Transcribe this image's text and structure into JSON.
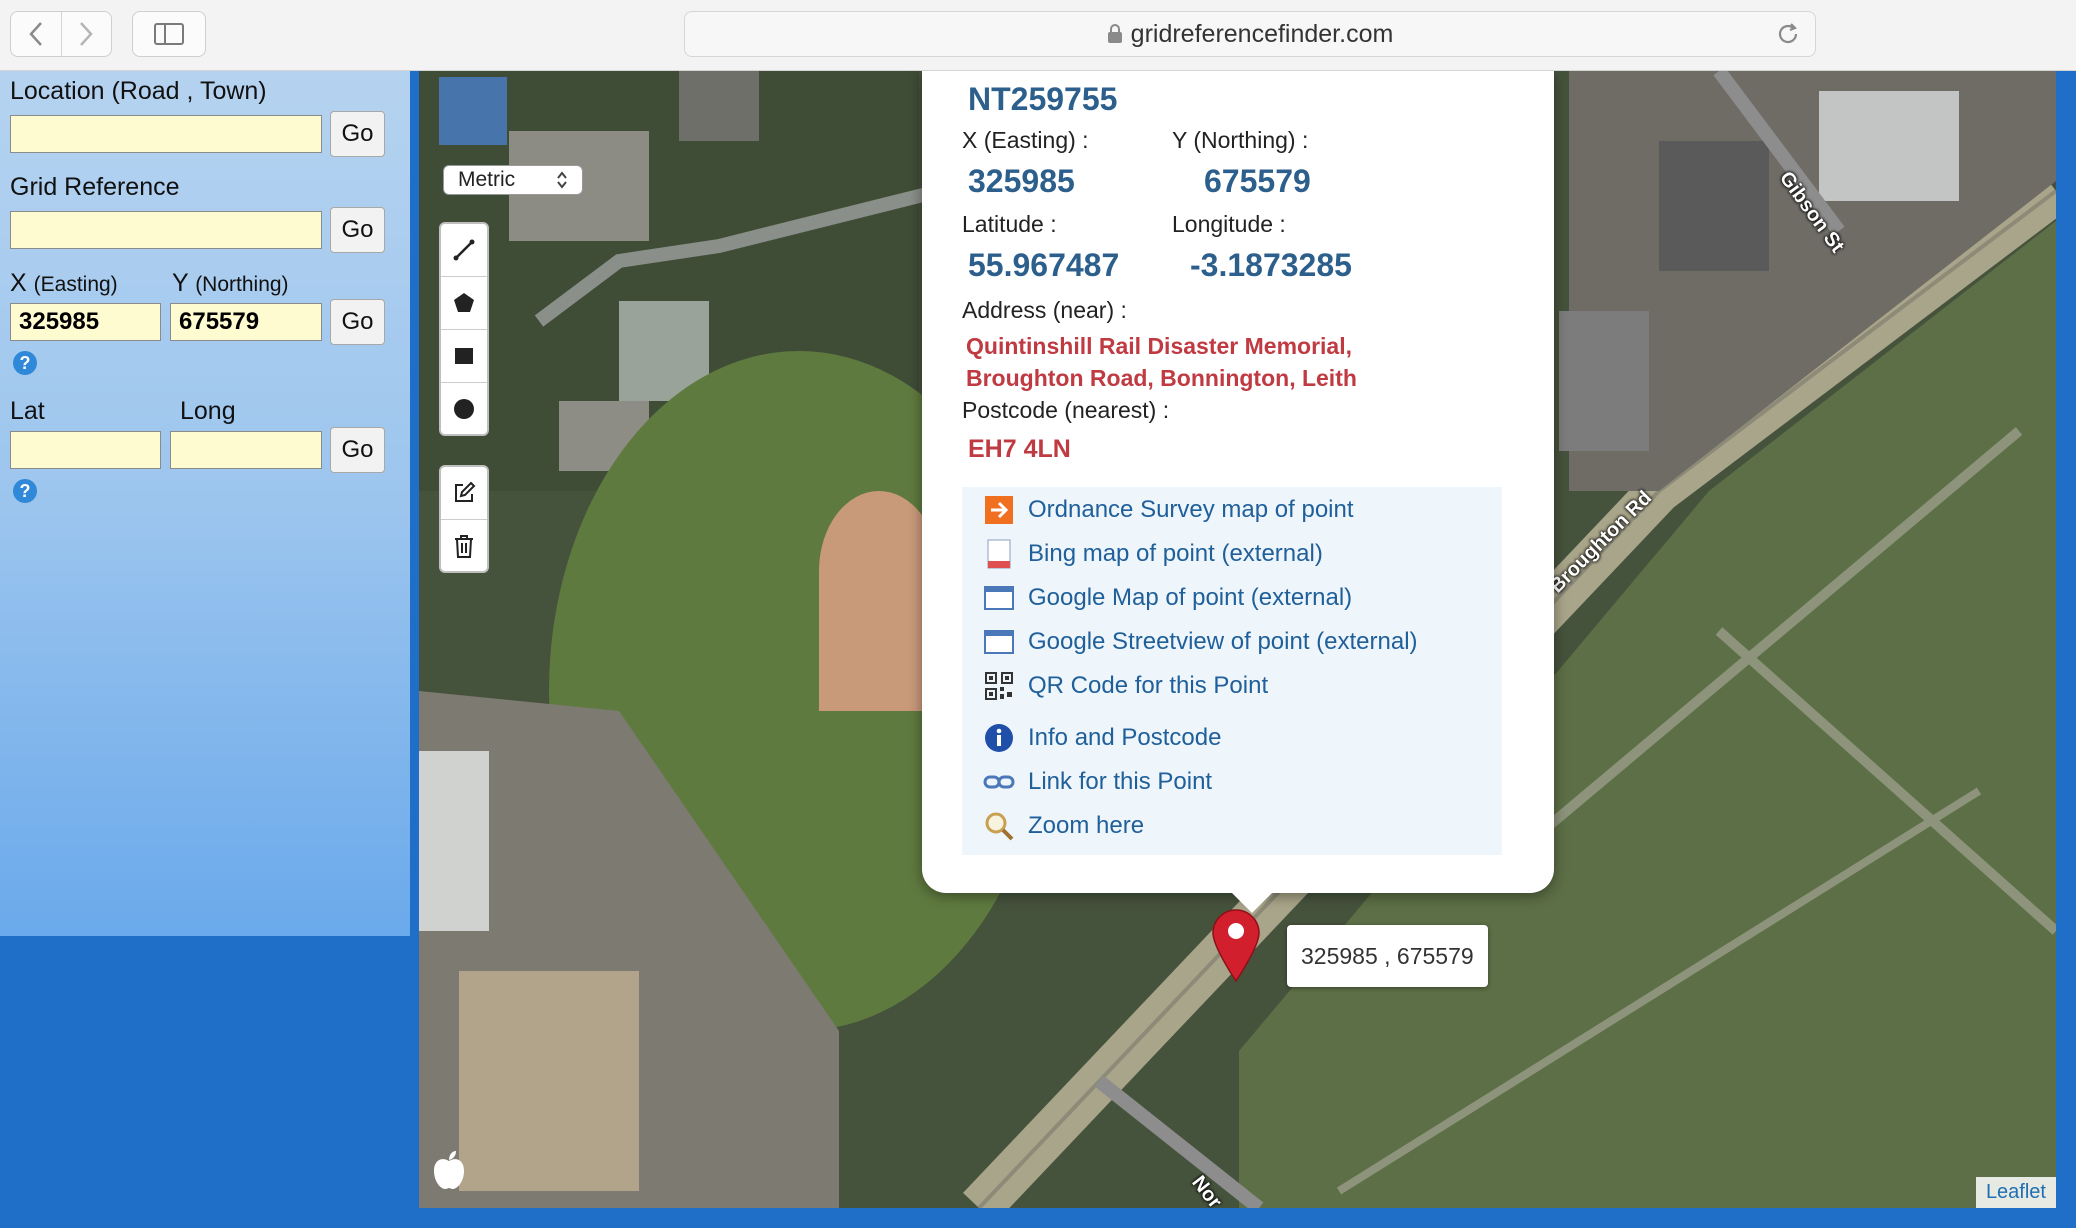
{
  "browser": {
    "url": "gridreferencefinder.com"
  },
  "panel": {
    "location_label": "Location (Road , Town)",
    "location_value": "",
    "gridref_label": "Grid Reference",
    "gridref_value": "",
    "x_label": "X",
    "x_sub": "(Easting)",
    "y_label": "Y",
    "y_sub": "(Northing)",
    "x_value": "325985",
    "y_value": "675579",
    "lat_label": "Lat",
    "long_label": "Long",
    "lat_value": "",
    "long_value": "",
    "go_label": "Go",
    "help_glyph": "?"
  },
  "map": {
    "units_select": "Metric",
    "tools": [
      "polyline-icon",
      "polygon-icon",
      "rectangle-icon",
      "circle-icon",
      "edit-icon",
      "trash-icon"
    ],
    "popup": {
      "grid_ref": "NT259755",
      "x_label": "X (Easting) :",
      "y_label": "Y (Northing) :",
      "x_value": "325985",
      "y_value": "675579",
      "lat_label": "Latitude :",
      "lon_label": "Longitude :",
      "lat_value": "55.967487",
      "lon_value": "-3.1873285",
      "address_label": "Address (near) :",
      "address_line1": "Quintinshill Rail Disaster Memorial,",
      "address_line2": "Broughton Road, Bonnington, Leith",
      "postcode_label": "Postcode (nearest) :",
      "postcode_value": "EH7 4LN",
      "links": [
        "Ordnance Survey map of point",
        "Bing map of point (external)",
        "Google Map of point (external)",
        "Google Streetview of point (external)",
        "QR Code for this Point",
        "Info and Postcode",
        "Link for this Point",
        "Zoom here"
      ]
    },
    "marker_label": "325985 , 675579",
    "street_labels": [
      "Gibson St",
      "Broughton Rd",
      "Nor"
    ],
    "attribution": "Leaflet",
    "colors": {
      "popup_value": "#2d5f8c",
      "address": "#c03a42",
      "link": "#1f5f9a",
      "marker": "#d21f2e"
    }
  }
}
